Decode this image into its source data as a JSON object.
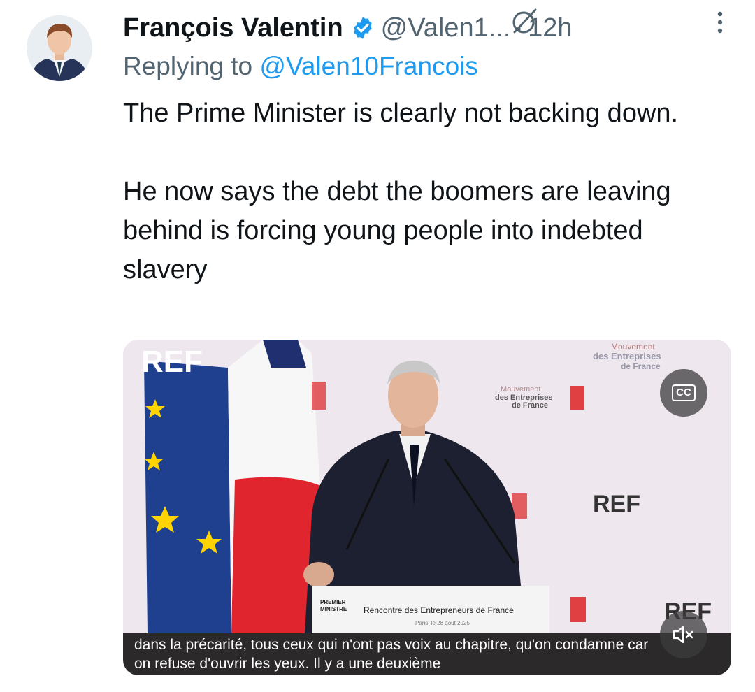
{
  "tweet": {
    "author_name": "François Valentin",
    "author_handle": "@Valen1...",
    "separator": "·",
    "time": "12h",
    "reply_prefix": "Replying to",
    "reply_mention": "@Valen10Francois",
    "text_p1": "The Prime Minister is clearly not backing down.",
    "text_p2": "He now says the debt the boomers are leaving behind is forcing young people into indebted slavery"
  },
  "video": {
    "subtitle_line1": "dans la précarité, tous ceux qui n'ont pas voix au chapitre, qu'on condamne car",
    "subtitle_line2": "on refuse d'ouvrir les yeux. Il y a une deuxième",
    "cc_label": "CC",
    "podium_text": "Rencontre des Entrepreneurs de France",
    "podium_date": "Paris, le 28 août 2025",
    "podium_org_line1": "PREMIER",
    "podium_org_line2": "MINISTRE",
    "logo_ref": "REF",
    "banner_line1": "Mouvement",
    "banner_line2": "des Entreprises",
    "banner_line3": "de France"
  },
  "icons": {
    "verified": "verified-badge-icon",
    "grok": "grok-icon",
    "more": "more-options-icon",
    "mute": "mute-icon",
    "cc": "closed-captions-icon"
  },
  "colors": {
    "link": "#1d9bf0",
    "secondary_text": "#536471",
    "primary_text": "#0f1419"
  }
}
